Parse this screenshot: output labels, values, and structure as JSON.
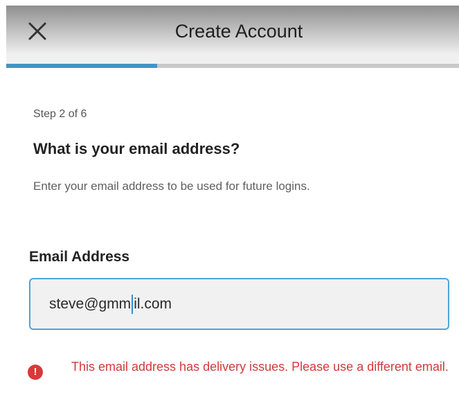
{
  "header": {
    "title": "Create Account",
    "close_icon": "close-icon",
    "progress_fraction": 0.333,
    "progress_color": "#3f96c6"
  },
  "step": {
    "text": "Step 2 of 6"
  },
  "question": {
    "heading": "What is your email address?",
    "hint": "Enter your email address to be used for future logins."
  },
  "email_field": {
    "label": "Email Address",
    "value_before_caret": "steve@gmm",
    "value_after_caret": "il.com",
    "border_color": "#4aa6d9"
  },
  "error": {
    "icon": "alert-icon",
    "glyph": "!",
    "message": "This email address has delivery issues. Please use a different email.",
    "color": "#cf3b3b"
  }
}
